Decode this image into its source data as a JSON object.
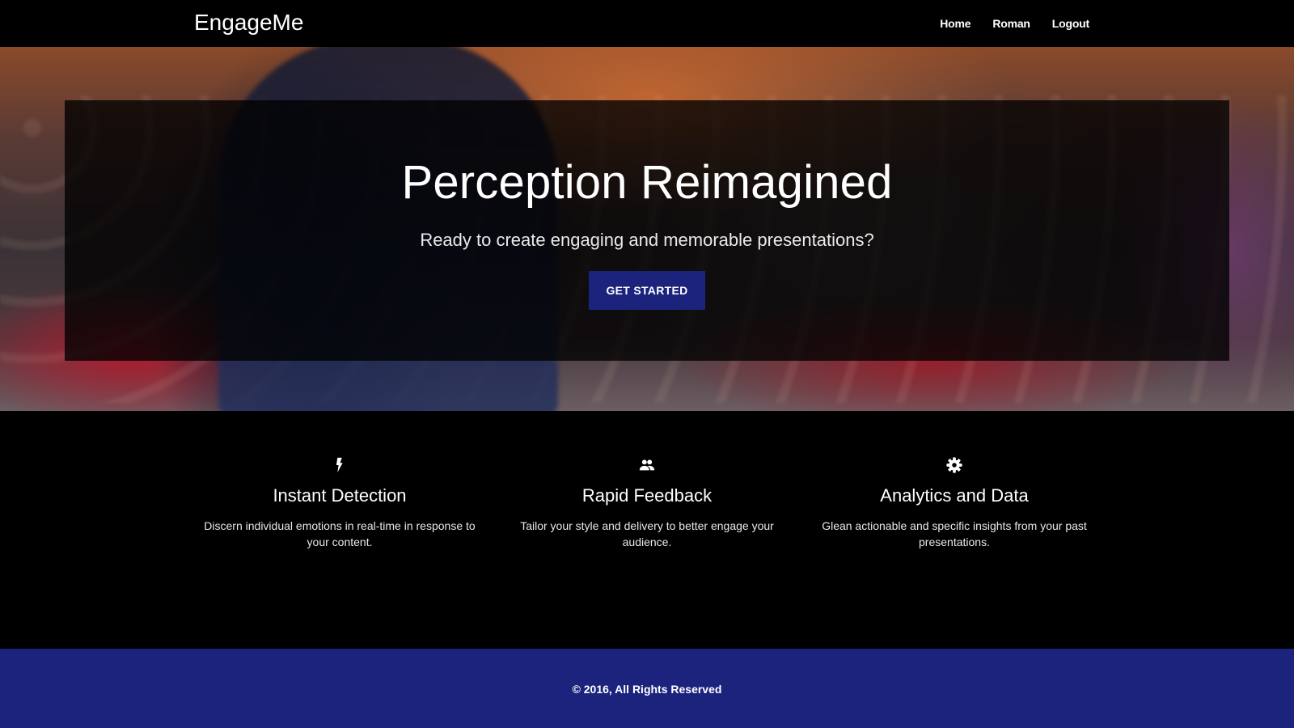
{
  "navbar": {
    "brand": "EngageMe",
    "links": [
      "Home",
      "Roman",
      "Logout"
    ]
  },
  "hero": {
    "title": "Perception Reimagined",
    "subtitle": "Ready to create engaging and memorable presentations?",
    "cta_label": "GET STARTED"
  },
  "features": [
    {
      "icon": "lightning-icon",
      "title": "Instant Detection",
      "text": "Discern individual emotions in real-time in response to your content."
    },
    {
      "icon": "people-icon",
      "title": "Rapid Feedback",
      "text": "Tailor your style and delivery to better engage your audience."
    },
    {
      "icon": "gear-icon",
      "title": "Analytics and Data",
      "text": "Glean actionable and specific insights from your past presentations."
    }
  ],
  "footer": {
    "text": "© 2016, All Rights Reserved"
  },
  "colors": {
    "accent": "#1b237d",
    "background": "#000000",
    "text": "#ffffff"
  }
}
